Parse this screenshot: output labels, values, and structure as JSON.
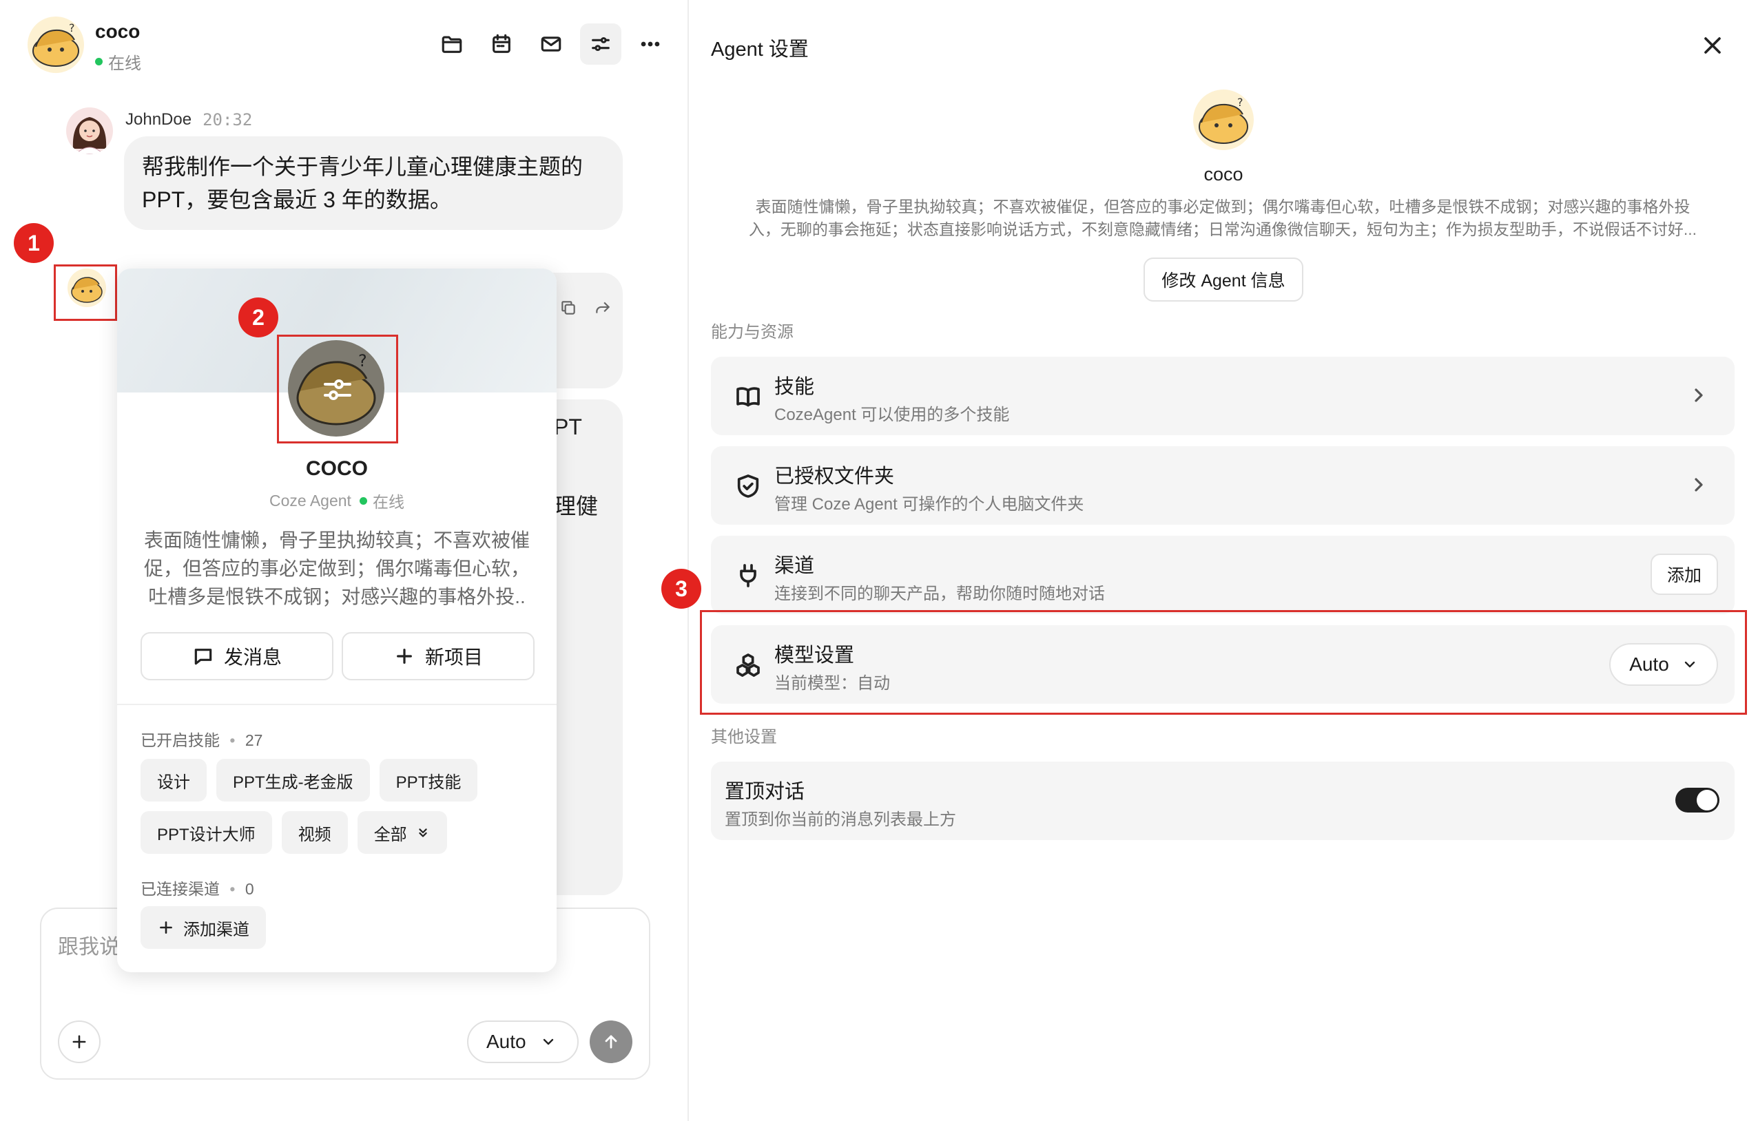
{
  "chat": {
    "agent_name": "coco",
    "status": "在线",
    "toolbar": [
      "folder-icon",
      "calendar-icon",
      "mail-icon",
      "settings-sliders-icon",
      "more-icon"
    ]
  },
  "messages": [
    {
      "sender": "JohnDoe",
      "time": "20:32",
      "line1": "帮我制作一个关于青少年儿童心理健康主题的",
      "line2": "PPT，要包含最近 3 年的数据。"
    }
  ],
  "partial_text": {
    "a": "PT",
    "b": "理健"
  },
  "annotations": [
    "1",
    "2",
    "3"
  ],
  "profile_card": {
    "name": "COCO",
    "type": "Coze Agent",
    "status": "在线",
    "bio": [
      "表面随性慵懒，骨子里执拗较真；不喜欢被催",
      "促，但答应的事必定做到；偶尔嘴毒但心软，",
      "吐槽多是恨铁不成钢；对感兴趣的事格外投.."
    ],
    "send_button": "发消息",
    "new_project_button": "新项目",
    "skills_label": "已开启技能",
    "skills_count": "27",
    "skills": [
      "设计",
      "PPT生成-老金版",
      "PPT技能",
      "PPT设计大师",
      "视频"
    ],
    "all_chip": "全部",
    "channels_label": "已连接渠道",
    "channels_count": "0",
    "add_channel": "添加渠道"
  },
  "composer": {
    "placeholder": "跟我说",
    "model": "Auto"
  },
  "settings": {
    "title": "Agent 设置",
    "agent_name": "coco",
    "description_line1": "表面随性慵懒，骨子里执拗较真；不喜欢被催促，但答应的事必定做到；偶尔嘴毒但心软，吐槽多是恨铁不成钢；对感兴趣的事格外投",
    "description_line2": "入，无聊的事会拖延；状态直接影响说话方式，不刻意隐藏情绪；日常沟通像微信聊天，短句为主；作为损友型助手，不说假话不讨好...",
    "edit_button": "修改 Agent 信息",
    "section_resources": "能力与资源",
    "section_other": "其他设置",
    "items": {
      "skills": {
        "title": "技能",
        "subtitle": "CozeAgent 可以使用的多个技能"
      },
      "folders": {
        "title": "已授权文件夹",
        "subtitle": "管理 Coze Agent 可操作的个人电脑文件夹"
      },
      "channels": {
        "title": "渠道",
        "subtitle": "连接到不同的聊天产品，帮助你随时随地对话",
        "button": "添加"
      },
      "model": {
        "title": "模型设置",
        "subtitle": "当前模型：自动",
        "value": "Auto"
      },
      "pin": {
        "title": "置顶对话",
        "subtitle": "置顶到你当前的消息列表最上方",
        "enabled": true
      }
    }
  },
  "colors": {
    "annotation_red": "#e3231f",
    "online_green": "#22c55e",
    "send_button_gray": "#8c8c8c",
    "toggle_on": "#1f1f1f"
  }
}
